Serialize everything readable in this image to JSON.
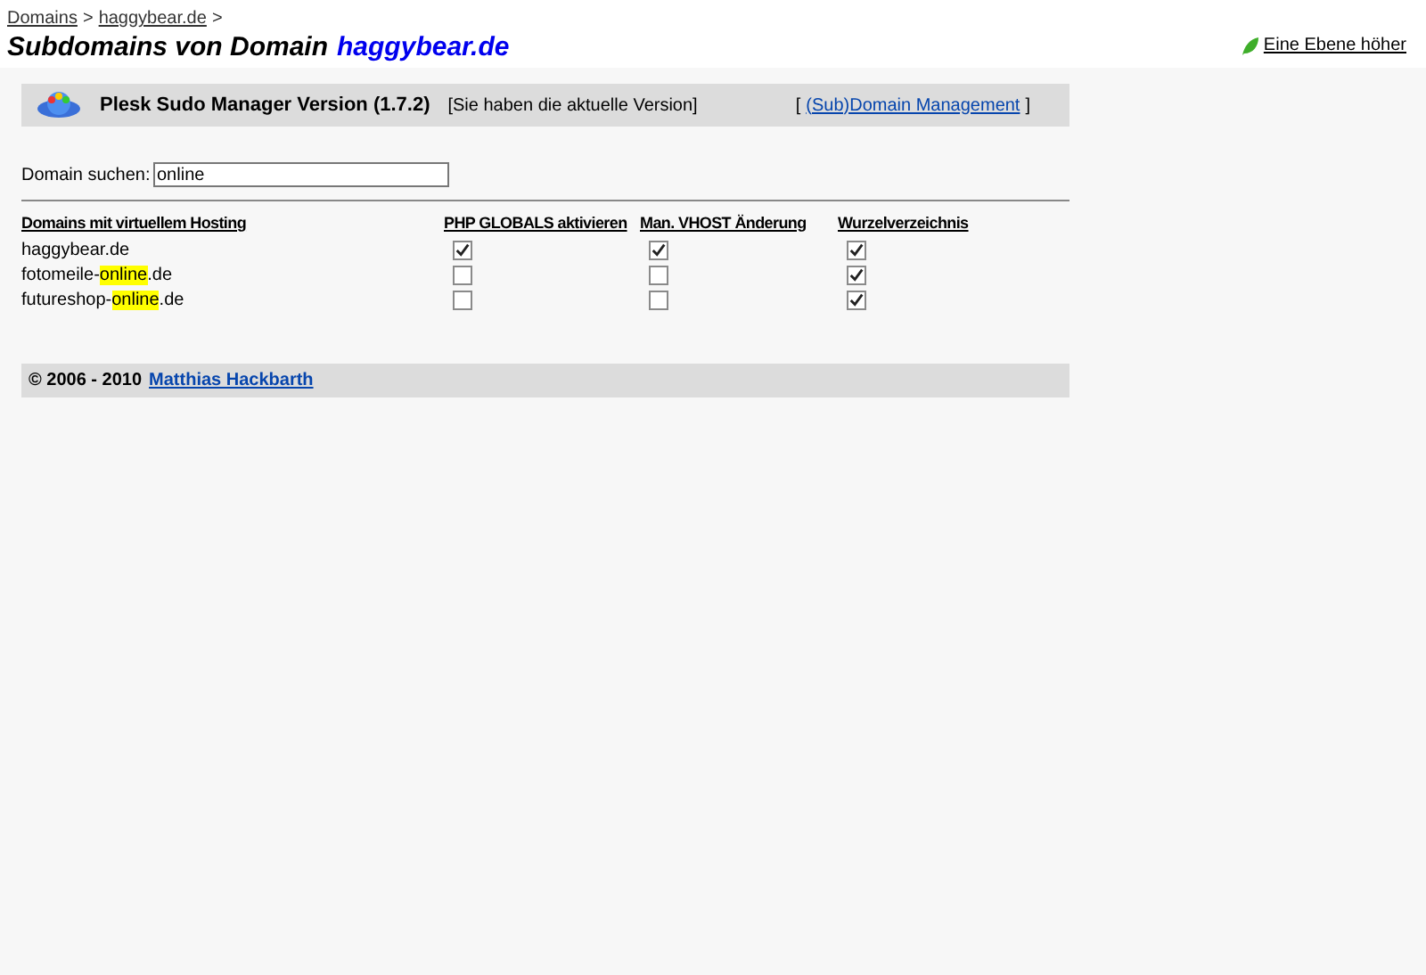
{
  "breadcrumb": [
    {
      "label": "Domains"
    },
    {
      "label": "haggybear.de"
    }
  ],
  "breadcrumb_separator": ">",
  "title": {
    "text": "Subdomains von Domain",
    "domain": "haggybear.de"
  },
  "up_link": "Eine Ebene höher",
  "banner": {
    "title": "Plesk Sudo Manager Version (1.7.2)",
    "status": "[Sie haben die aktuelle Version]",
    "link_open": "[",
    "link": "(Sub)Domain Management",
    "link_close": "]"
  },
  "search": {
    "label": "Domain suchen:",
    "value": "online"
  },
  "table": {
    "columns": [
      "Domains mit virtuellem Hosting",
      "PHP GLOBALS aktivieren",
      "Man. VHOST Änderung",
      "Wurzelverzeichnis"
    ],
    "rows": [
      {
        "domain": [
          {
            "text": "haggybear.de",
            "highlight": false
          }
        ],
        "php_globals": true,
        "vhost": true,
        "root": true
      },
      {
        "domain": [
          {
            "text": "fotomeile-",
            "highlight": false
          },
          {
            "text": "online",
            "highlight": true
          },
          {
            "text": ".de",
            "highlight": false
          }
        ],
        "php_globals": false,
        "vhost": false,
        "root": true
      },
      {
        "domain": [
          {
            "text": "futureshop-",
            "highlight": false
          },
          {
            "text": "online",
            "highlight": true
          },
          {
            "text": ".de",
            "highlight": false
          }
        ],
        "php_globals": false,
        "vhost": false,
        "root": true
      }
    ]
  },
  "footer": {
    "copyright": "© 2006 - 2010",
    "author": "Matthias Hackbarth"
  }
}
